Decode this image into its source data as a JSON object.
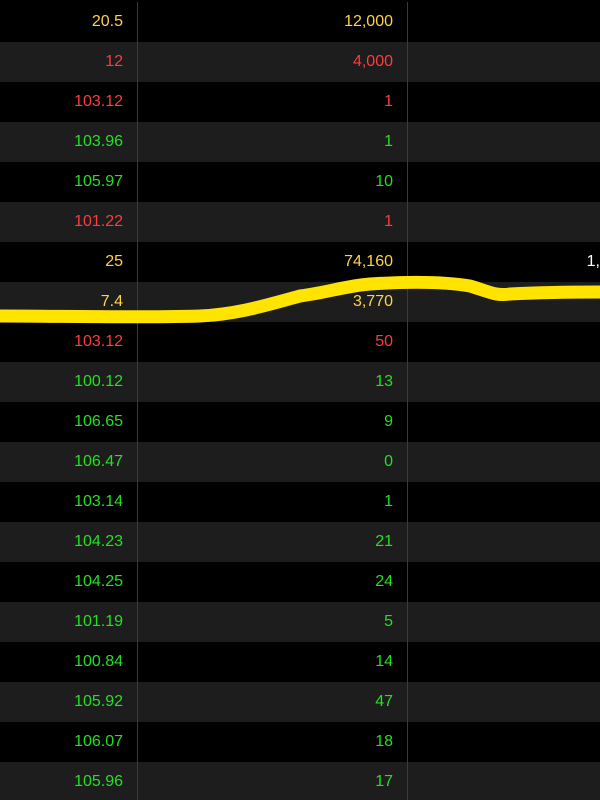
{
  "colors": {
    "background": "#000000",
    "stripe": "#1d1d1d",
    "yellow": "#ffd24a",
    "red": "#ff3b3b",
    "green": "#22e022",
    "white": "#ffffff",
    "highlight": "#ffe400"
  },
  "rows": [
    {
      "price": "20.5",
      "qty": "12,000",
      "extra": "",
      "color": "yellow"
    },
    {
      "price": "12",
      "qty": "4,000",
      "extra": "",
      "color": "red"
    },
    {
      "price": "103.12",
      "qty": "1",
      "extra": "",
      "color": "red"
    },
    {
      "price": "103.96",
      "qty": "1",
      "extra": "",
      "color": "green"
    },
    {
      "price": "105.97",
      "qty": "10",
      "extra": "",
      "color": "green"
    },
    {
      "price": "101.22",
      "qty": "1",
      "extra": "",
      "color": "red"
    },
    {
      "price": "25",
      "qty": "74,160",
      "extra": "1,",
      "color": "yellow"
    },
    {
      "price": "7.4",
      "qty": "3,770",
      "extra": "",
      "color": "yellow"
    },
    {
      "price": "103.12",
      "qty": "50",
      "extra": "",
      "color": "red"
    },
    {
      "price": "100.12",
      "qty": "13",
      "extra": "",
      "color": "green"
    },
    {
      "price": "106.65",
      "qty": "9",
      "extra": "",
      "color": "green"
    },
    {
      "price": "106.47",
      "qty": "0",
      "extra": "",
      "color": "green"
    },
    {
      "price": "103.14",
      "qty": "1",
      "extra": "",
      "color": "green"
    },
    {
      "price": "104.23",
      "qty": "21",
      "extra": "",
      "color": "green"
    },
    {
      "price": "104.25",
      "qty": "24",
      "extra": "",
      "color": "green"
    },
    {
      "price": "101.19",
      "qty": "5",
      "extra": "",
      "color": "green"
    },
    {
      "price": "100.84",
      "qty": "14",
      "extra": "",
      "color": "green"
    },
    {
      "price": "105.92",
      "qty": "47",
      "extra": "",
      "color": "green"
    },
    {
      "price": "106.07",
      "qty": "18",
      "extra": "",
      "color": "green"
    },
    {
      "price": "105.96",
      "qty": "17",
      "extra": "",
      "color": "green"
    }
  ]
}
